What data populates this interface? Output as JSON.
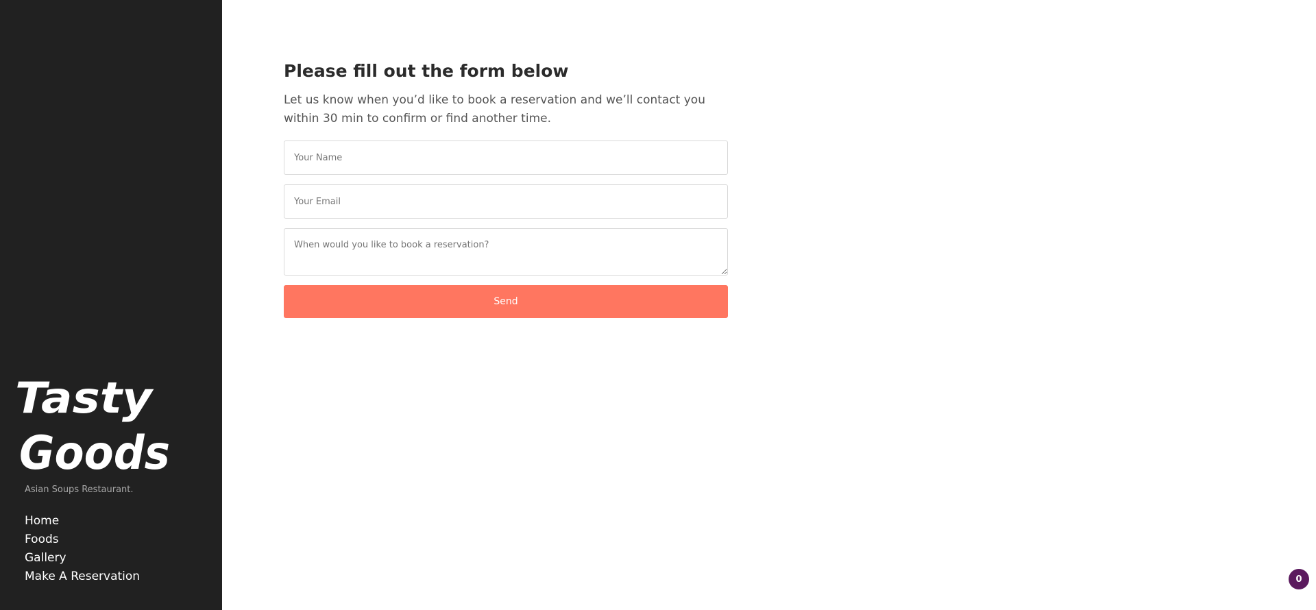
{
  "brand": {
    "logo_line1": "Tasty",
    "logo_line2": "Goods",
    "tagline": "Asian Soups Restaurant."
  },
  "nav": {
    "items": [
      {
        "label": "Home"
      },
      {
        "label": "Foods"
      },
      {
        "label": "Gallery"
      },
      {
        "label": "Make A Reservation"
      }
    ]
  },
  "form": {
    "title": "Please fill out the form below",
    "description": "Let us know when you’d like to book a reservation and we’ll contact you within 30 min to confirm or find another time.",
    "name_placeholder": "Your Name",
    "email_placeholder": "Your Email",
    "message_placeholder": "When would you like to book a reservation?",
    "send_label": "Send"
  },
  "cart": {
    "count": "0"
  },
  "colors": {
    "sidebar_bg": "#212121",
    "accent": "#ff7660",
    "badge_bg": "#5b1a5e"
  }
}
